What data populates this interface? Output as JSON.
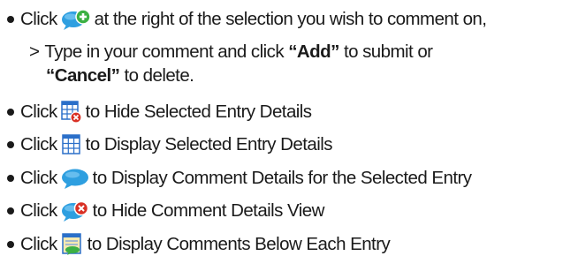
{
  "instructions": [
    {
      "click_word": "Click",
      "icon": "add-comment-icon",
      "text": "at the right of the selection you wish to comment on,"
    },
    {
      "marker": ">",
      "text_before": "Type in your comment and click",
      "add_label": "“Add”",
      "text_middle": "to submit or"
    },
    {
      "cancel_label": "“Cancel”",
      "text_after": "to delete."
    },
    {
      "click_word": "Click",
      "icon": "hide-entry-details-icon",
      "text": "to Hide Selected Entry Details"
    },
    {
      "click_word": "Click",
      "icon": "display-entry-details-icon",
      "text": "to Display Selected Entry Details"
    },
    {
      "click_word": "Click",
      "icon": "display-comment-details-icon",
      "text": "to Display Comment Details for the Selected Entry"
    },
    {
      "click_word": "Click",
      "icon": "hide-comment-details-icon",
      "text": "to Hide Comment Details View"
    },
    {
      "click_word": "Click",
      "icon": "display-comments-below-icon",
      "text": "to Display Comments Below Each Entry"
    }
  ],
  "colors": {
    "text": "#1a1a1a",
    "bubble_blue": "#2e9fe0",
    "plus_green": "#3cb043",
    "close_red": "#d93025",
    "grid_blue": "#2a6fc9"
  }
}
